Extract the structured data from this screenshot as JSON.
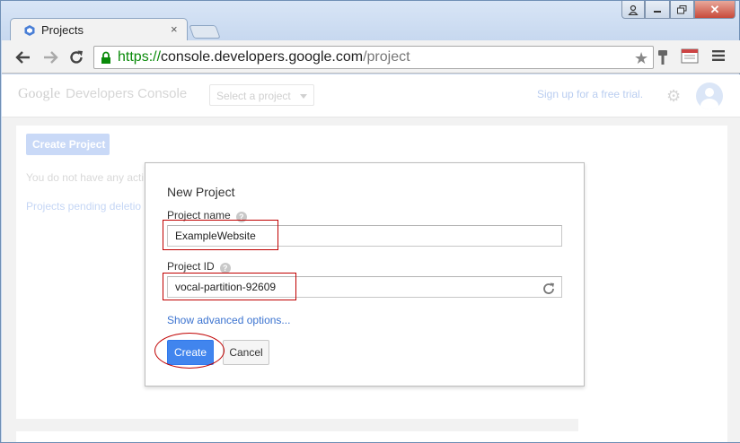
{
  "browser": {
    "tab_title": "Projects",
    "tab_close": "×",
    "url_scheme": "https://",
    "url_host": "console.developers.google.com",
    "url_path": "/project",
    "window_close": "✕"
  },
  "header": {
    "logo_google": "Google",
    "logo_product": "Developers Console",
    "project_select_placeholder": "Select a project",
    "signup_link": "Sign up for a free trial."
  },
  "background_page": {
    "create_project_button": "Create Project",
    "no_access_text": "You do not have any acti",
    "pending_link": "Projects pending deletio"
  },
  "dialog": {
    "title": "New Project",
    "project_name_label": "Project name",
    "project_name_value": "ExampleWebsite",
    "project_id_label": "Project ID",
    "project_id_value": "vocal-partition-92609",
    "help_glyph": "?",
    "advanced_link": "Show advanced options...",
    "create_button": "Create",
    "cancel_button": "Cancel"
  },
  "colors": {
    "primary_button": "#4185ee",
    "link": "#3b73d0",
    "annotation": "#c00000",
    "secure_url": "#0a8a0a"
  }
}
